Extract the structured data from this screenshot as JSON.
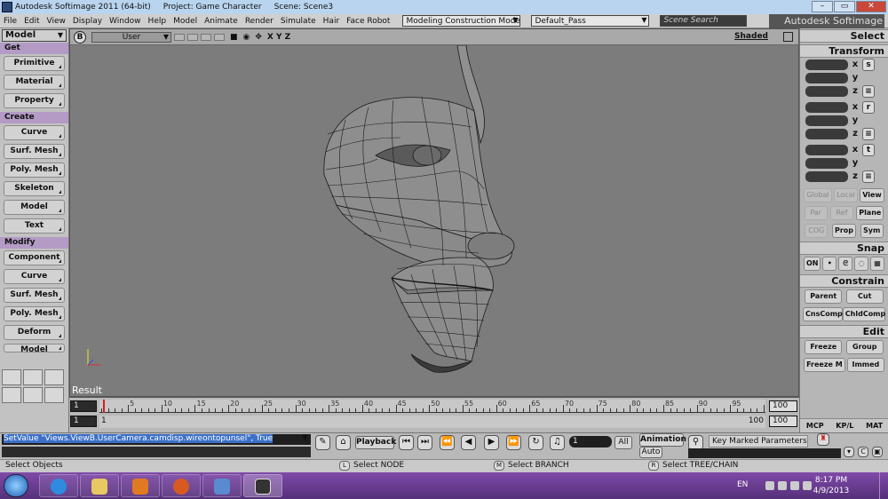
{
  "window": {
    "title": "Autodesk Softimage 2011 (64-bit)",
    "project": "Project: Game Character",
    "scene": "Scene: Scene3",
    "brand": "Autodesk Softimage"
  },
  "menubar": {
    "items": [
      "File",
      "Edit",
      "View",
      "Display",
      "Window",
      "Help",
      "Model",
      "Animate",
      "Render",
      "Simulate",
      "Hair",
      "Face Robot"
    ],
    "construction_mode": "Modeling Construction Mode",
    "pass": "Default_Pass",
    "search_placeholder": "Scene Search"
  },
  "left_toolbar": {
    "mode": "Model",
    "sections": [
      {
        "title": "Get",
        "buttons": [
          "Primitive",
          "Material",
          "Property"
        ]
      },
      {
        "title": "Create",
        "buttons": [
          "Curve",
          "Surf. Mesh",
          "Poly. Mesh",
          "Skeleton",
          "Model",
          "Text"
        ]
      },
      {
        "title": "Modify",
        "buttons": [
          "Component",
          "Curve",
          "Surf. Mesh",
          "Poly. Mesh",
          "Deform",
          "Model"
        ]
      }
    ]
  },
  "viewport": {
    "letter": "B",
    "camera": "User",
    "axes": "X Y Z",
    "shading": "Shaded",
    "result_label": "Result"
  },
  "timeline": {
    "start_frame": "1",
    "start_frame2": "1",
    "start_mark": "1",
    "end_frame": "100",
    "end_frame2": "100",
    "end_mark": "100",
    "ticks": [
      "5",
      "10",
      "15",
      "20",
      "25",
      "30",
      "35",
      "40",
      "45",
      "50",
      "55",
      "60",
      "65",
      "70",
      "75",
      "80",
      "85",
      "90",
      "95"
    ]
  },
  "right_panel": {
    "select_title": "Select",
    "transform_title": "Transform",
    "scale_btn": "s",
    "rotate_btn": "r",
    "translate_btn": "t",
    "axis_labels": [
      "x",
      "y",
      "z"
    ],
    "ref_modes": [
      "Global",
      "Local",
      "View",
      "Par",
      "Ref",
      "Plane",
      "COG",
      "Prop",
      "Sym"
    ],
    "snap_title": "Snap",
    "snap_on": "ON",
    "constrain_title": "Constrain",
    "constrain_buttons": [
      "Parent",
      "Cut",
      "CnsComp",
      "ChldComp"
    ],
    "edit_title": "Edit",
    "edit_buttons": [
      "Freeze",
      "Group",
      "Freeze M",
      "Immed"
    ],
    "bottom_tabs": [
      "MCP",
      "KP/L",
      "MAT"
    ]
  },
  "command_bar": {
    "script_line": "SetValue \"Views.ViewB.UserCamera.camdisp.wireontopunsel\", True",
    "playback_label": "Playback",
    "current_frame": "1",
    "all_label": "All",
    "animation_label": "Animation",
    "auto_label": "Auto",
    "key_marked": "Key Marked Parameters"
  },
  "status_bar": {
    "message": "Select Objects",
    "left_mouse_key": "L",
    "left_mouse": "Select NODE",
    "middle_mouse_key": "M",
    "middle_mouse": "Select BRANCH",
    "right_mouse_key": "R",
    "right_mouse": "Select TREE/CHAIN"
  },
  "taskbar": {
    "language": "EN",
    "time": "8:17 PM",
    "date": "4/9/2013"
  }
}
